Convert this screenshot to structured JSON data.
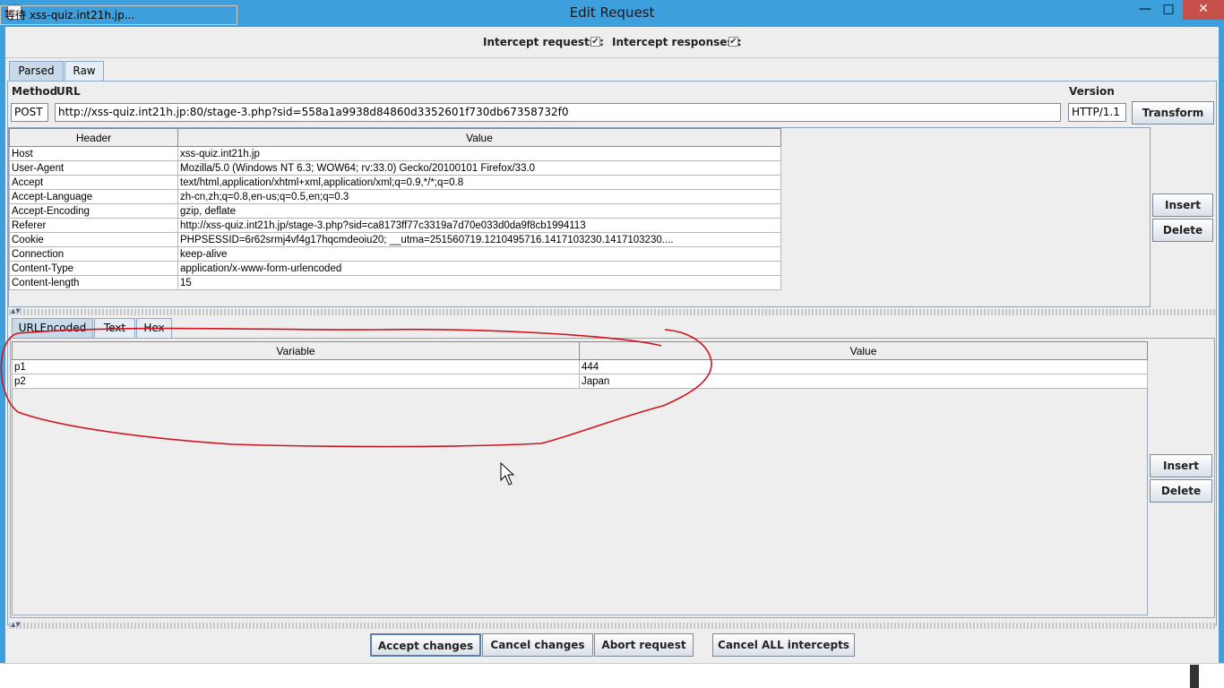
{
  "window": {
    "title": "Edit Request",
    "minimize": "—",
    "maximize": "□",
    "close": "✕"
  },
  "intercept": {
    "requests_label": "Intercept requests :",
    "responses_label": "Intercept responses :",
    "requests_checked": true,
    "responses_checked": true,
    "check": "✔"
  },
  "tabs": [
    {
      "label": "Parsed"
    },
    {
      "label": "Raw"
    }
  ],
  "request": {
    "method_label": "Method",
    "url_label": "URL",
    "version_label": "Version",
    "method": "POST",
    "url": "http://xss-quiz.int21h.jp:80/stage-3.php?sid=558a1a9938d84860d3352601f730db67358732f0",
    "version": "HTTP/1.1",
    "transform_button": "Transform"
  },
  "headers": {
    "columns": [
      "Header",
      "Value"
    ],
    "rows": [
      [
        "Host",
        "xss-quiz.int21h.jp"
      ],
      [
        "User-Agent",
        "Mozilla/5.0 (Windows NT 6.3; WOW64; rv:33.0) Gecko/20100101 Firefox/33.0"
      ],
      [
        "Accept",
        "text/html,application/xhtml+xml,application/xml;q=0.9,*/*;q=0.8"
      ],
      [
        "Accept-Language",
        "zh-cn,zh;q=0.8,en-us;q=0.5,en;q=0.3"
      ],
      [
        "Accept-Encoding",
        "gzip, deflate"
      ],
      [
        "Referer",
        "http://xss-quiz.int21h.jp/stage-3.php?sid=ca8173ff77c3319a7d70e033d0da9f8cb1994113"
      ],
      [
        "Cookie",
        "PHPSESSID=6r62srmj4vf4g17hqcmdeoiu20; __utma=251560719.1210495716.1417103230.1417103230...."
      ],
      [
        "Connection",
        "keep-alive"
      ],
      [
        "Content-Type",
        "application/x-www-form-urlencoded"
      ],
      [
        "Content-length",
        "15"
      ]
    ],
    "insert_button": "Insert",
    "delete_button": "Delete"
  },
  "body_tabs": [
    {
      "label": "URLEncoded"
    },
    {
      "label": "Text"
    },
    {
      "label": "Hex"
    }
  ],
  "params": {
    "columns": [
      "Variable",
      "Value"
    ],
    "rows": [
      [
        "p1",
        "444"
      ],
      [
        "p2",
        "Japan"
      ]
    ],
    "insert_button": "Insert",
    "delete_button": "Delete"
  },
  "actions": {
    "accept": "Accept changes",
    "cancel": "Cancel changes",
    "abort": "Abort request",
    "cancel_all": "Cancel ALL intercepts"
  },
  "status": {
    "text": "等待 xss-quiz.int21h.jp..."
  },
  "colors": {
    "titlebar": "#3d9fdc",
    "close": "#c7504a",
    "annotation": "#d0141e"
  }
}
